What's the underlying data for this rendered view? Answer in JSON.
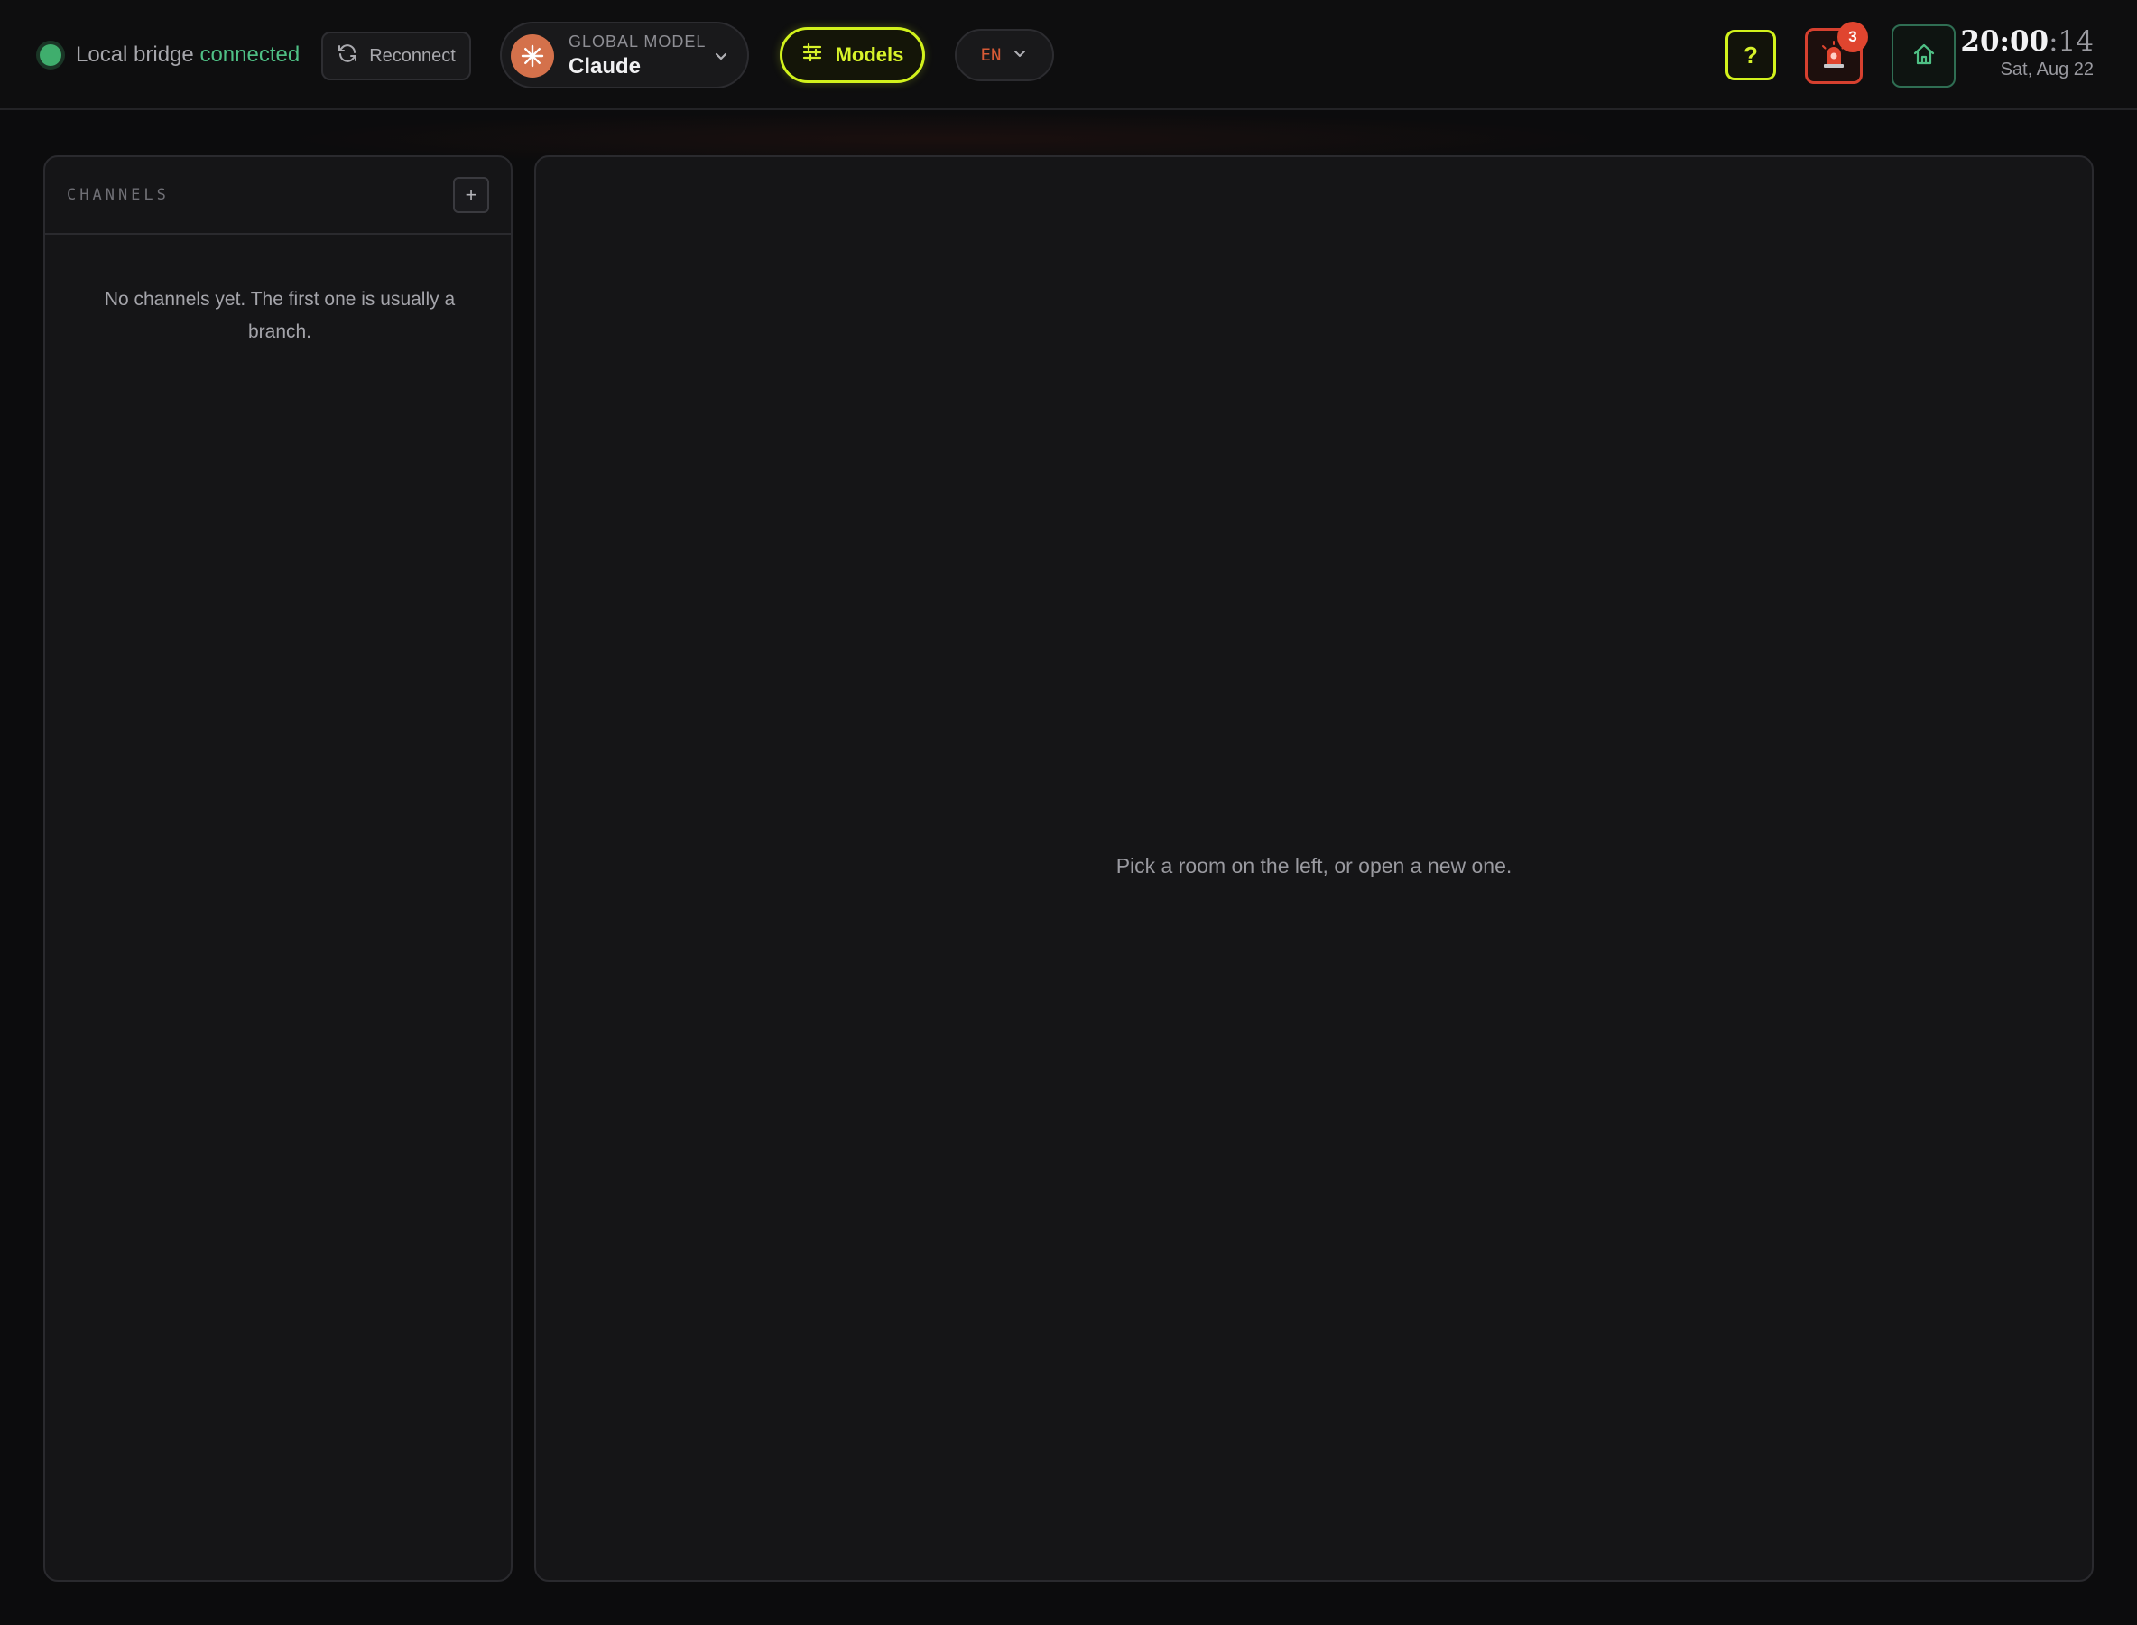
{
  "header": {
    "status_label": "Local bridge",
    "status_value": "connected",
    "reconnect_label": "Reconnect",
    "model": {
      "caption": "GLOBAL MODEL",
      "name": "Claude",
      "accent": "#d4714b"
    },
    "models_label": "Models",
    "language": "EN",
    "help_label": "?",
    "alert_count": "3",
    "clock": {
      "time_hm": "20:00",
      "time_sec": ":14",
      "date": "Sat, Aug 22"
    },
    "icons": [
      "refresh-icon",
      "claude-sunburst-icon",
      "chevron-down-icon",
      "sliders-icon",
      "siren-icon",
      "home-icon"
    ]
  },
  "sidebar": {
    "title": "CHANNELS",
    "add_label": "+",
    "empty_text": "No channels yet. The first one is usually a branch."
  },
  "main": {
    "empty_text": "Pick a room on the left, or open a new one."
  },
  "colors": {
    "accent_lime": "#d2f21c",
    "connected_green": "#4fc085",
    "alert_red": "#e0452f",
    "language_orange": "#d85a36"
  }
}
